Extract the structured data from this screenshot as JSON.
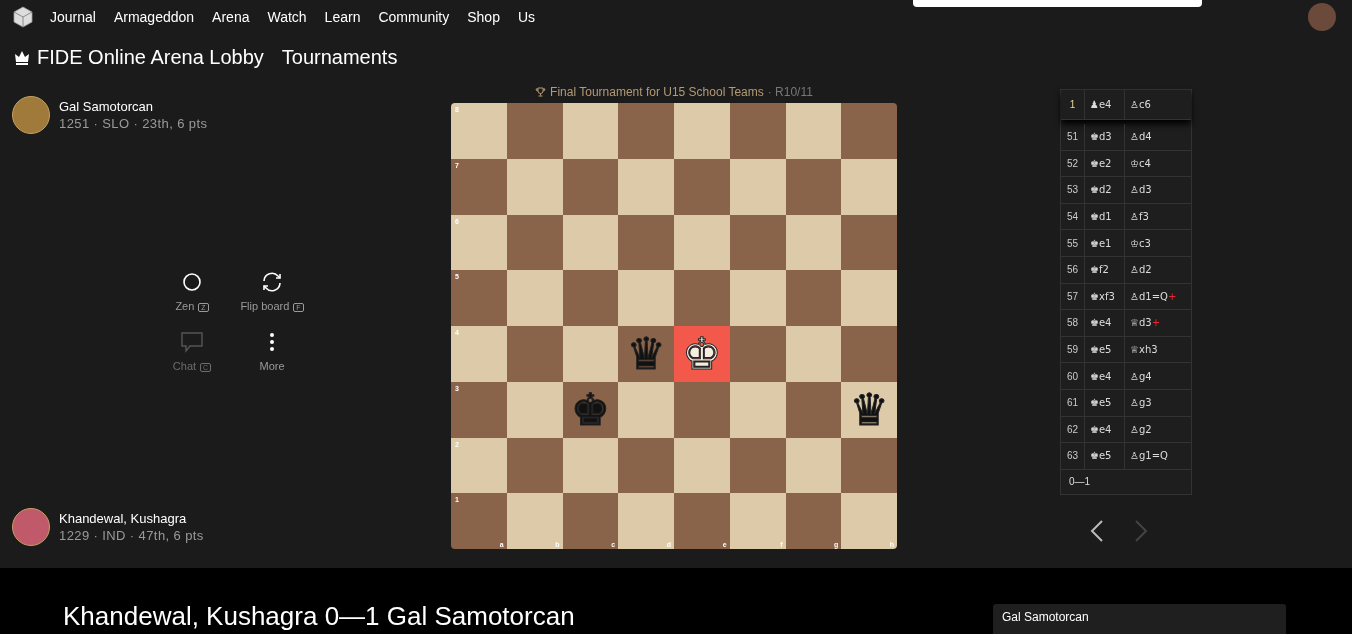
{
  "nav": {
    "items": [
      "Journal",
      "Armageddon",
      "Arena",
      "Watch",
      "Learn",
      "Community",
      "Shop",
      "Us"
    ]
  },
  "breadcrumbs": [
    "FIDE Online Arena Lobby",
    "Tournaments"
  ],
  "tournament": {
    "name": "Final Tournament for U15 School Teams",
    "round": "· R10/11"
  },
  "players": [
    {
      "name": "Gal Samotorcan",
      "info": "1251 · SLO · 23th, 6 pts"
    },
    {
      "name": "Khandewal, Kushagra",
      "info": "1229 · IND · 47th, 6 pts"
    }
  ],
  "controls": [
    {
      "label": "Zen",
      "key": "Z",
      "kind": "zen",
      "disabled": false
    },
    {
      "label": "Flip board",
      "key": "F",
      "kind": "flip",
      "disabled": false
    },
    {
      "label": "Chat",
      "key": "C",
      "kind": "chat",
      "disabled": true
    },
    {
      "label": "More",
      "kind": "more",
      "disabled": false
    }
  ],
  "board": {
    "files": [
      "a",
      "b",
      "c",
      "d",
      "e",
      "f",
      "g",
      "h"
    ],
    "ranks": [
      {
        "label": "8",
        "cells": [
          null,
          null,
          null,
          null,
          null,
          null,
          null,
          null
        ]
      },
      {
        "label": "7",
        "cells": [
          null,
          null,
          null,
          null,
          null,
          null,
          null,
          null
        ]
      },
      {
        "label": "6",
        "cells": [
          null,
          null,
          null,
          null,
          null,
          null,
          null,
          null
        ]
      },
      {
        "label": "5",
        "cells": [
          null,
          null,
          null,
          null,
          null,
          null,
          null,
          null
        ]
      },
      {
        "label": "4",
        "cells": [
          null,
          null,
          null,
          {
            "glyph": "♛",
            "color": "#111111",
            "check": false
          },
          {
            "glyph": "♚",
            "color": "#f4eee0",
            "check": true
          },
          null,
          null,
          null
        ]
      },
      {
        "label": "3",
        "cells": [
          null,
          null,
          {
            "glyph": "♚",
            "color": "#111111",
            "check": false
          },
          null,
          null,
          null,
          null,
          {
            "glyph": "♛",
            "color": "#111111",
            "check": false
          }
        ]
      },
      {
        "label": "2",
        "cells": [
          null,
          null,
          null,
          null,
          null,
          null,
          null,
          null
        ]
      },
      {
        "label": "1",
        "cells": [
          null,
          null,
          null,
          null,
          null,
          null,
          null,
          null
        ]
      }
    ]
  },
  "moves": [
    {
      "number": "1",
      "white": "♟e4",
      "black": "♙c6"
    },
    {
      "number": "51",
      "white": "♚d3",
      "black": "♙d4"
    },
    {
      "number": "52",
      "white": "♚e2",
      "black": "♔c4"
    },
    {
      "number": "53",
      "white": "♚d2",
      "black": "♙d3"
    },
    {
      "number": "54",
      "white": "♚d1",
      "black": "♙f3"
    },
    {
      "number": "55",
      "white": "♚e1",
      "black": "♔c3"
    },
    {
      "number": "56",
      "white": "♚f2",
      "black": "♙d2"
    },
    {
      "number": "57",
      "white": "♚xf3",
      "black": "♙d1=Q",
      "black_suffix": "+"
    },
    {
      "number": "58",
      "white": "♚e4",
      "black": "♕d3",
      "black_suffix": "+"
    },
    {
      "number": "59",
      "white": "♚e5",
      "black": "♕xh3"
    },
    {
      "number": "60",
      "white": "♚e4",
      "black": "♙g4"
    },
    {
      "number": "61",
      "white": "♚e5",
      "black": "♙g3"
    },
    {
      "number": "62",
      "white": "♚e4",
      "black": "♙g2"
    },
    {
      "number": "63",
      "white": "♚e5",
      "black": "♙g1=Q"
    }
  ],
  "result": "0—1",
  "navigation": [
    {
      "kind": "prev",
      "disabled": false
    },
    {
      "kind": "next",
      "disabled": true
    }
  ],
  "footer": {
    "title": "Khandewal, Kushagra 0—1 Gal Samotorcan",
    "card_name": "Gal Samotorcan"
  }
}
